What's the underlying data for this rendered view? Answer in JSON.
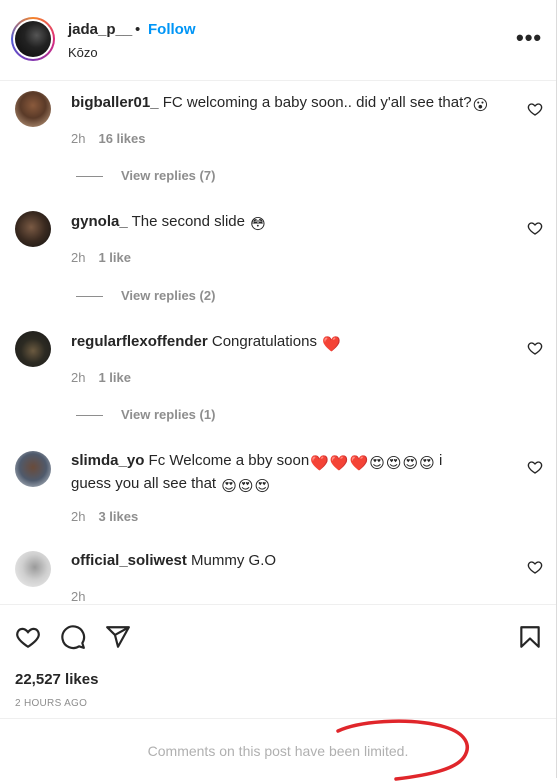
{
  "post": {
    "username": "jada_p__",
    "separator": "•",
    "follow_label": "Follow",
    "location": "Kōzo",
    "more_icon": "more-horizontal-icon"
  },
  "comments": [
    {
      "username": "bigballer01_",
      "text": "FC welcoming a baby soon.. did y'all see that?",
      "emojis": [
        "😮"
      ],
      "time": "2h",
      "likes": "16 likes",
      "replies": "View replies (7)"
    },
    {
      "username": "gynola_",
      "text": "The second slide",
      "emojis": [
        "😳"
      ],
      "time": "2h",
      "likes": "1 like",
      "replies": "View replies (2)"
    },
    {
      "username": "regularflexoffender",
      "text": "Congratulations",
      "emojis": [
        "❤️"
      ],
      "time": "2h",
      "likes": "1 like",
      "replies": "View replies (1)"
    },
    {
      "username": "slimda_yo",
      "text_line1": "Fc Welcome a bby soon",
      "emojis_line1": [
        "❤️",
        "❤️",
        "❤️",
        "😍",
        "😍",
        "😍",
        "😍"
      ],
      "text_line1_end": "i",
      "text_line2": "guess you all see that",
      "emojis_line2": [
        "😍",
        "😍",
        "😍"
      ],
      "time": "2h",
      "likes": "3 likes"
    },
    {
      "username": "official_soliwest",
      "text": "Mummy G.O",
      "time": "2h"
    }
  ],
  "actions": {
    "like_icon": "heart-icon",
    "comment_icon": "comment-icon",
    "share_icon": "share-icon",
    "save_icon": "bookmark-icon"
  },
  "likes_count": "22,527 likes",
  "timestamp": "2 HOURS AGO",
  "comments_limited": "Comments on this post have been limited.",
  "colors": {
    "link_blue": "#0095f6",
    "text": "#262626",
    "secondary": "#8e8e8e",
    "scribble_red": "#e0262b"
  }
}
